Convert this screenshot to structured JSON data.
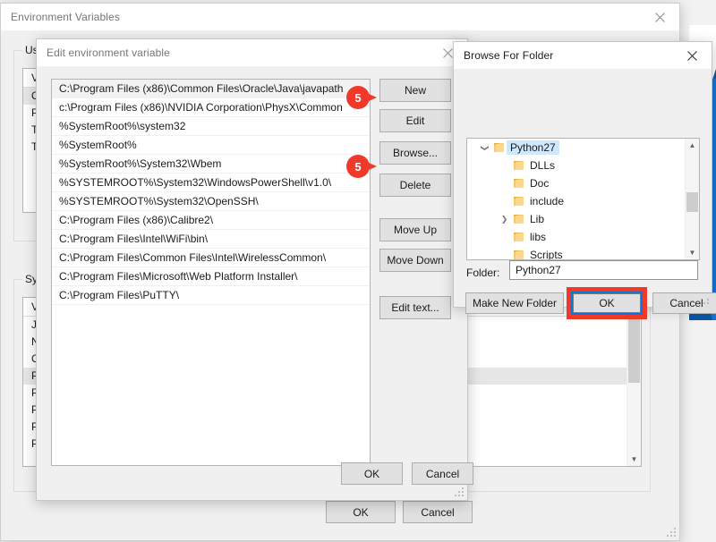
{
  "desktop": {
    "wallpaper_color": "#0b57a4"
  },
  "env_window": {
    "title": "Environment Variables",
    "close_icon": "close-icon",
    "user_group": "User variables for user",
    "system_group": "System variables",
    "user_header": "Variable",
    "user_rows": [
      "OneDrive",
      "Path",
      "TEMP",
      "TMP"
    ],
    "system_header": "Variable",
    "system_rows": [
      "JAVA_HOME",
      "NUMBER_OF_PROCESSORS",
      "OS",
      "Path",
      "PATHEXT",
      "PROCESSOR_ARCHITECTURE",
      "PROCESSOR_IDENTIFIER",
      "PR"
    ],
    "system_selected_index": 3,
    "user_selected_index": 0,
    "ok_label": "OK",
    "cancel_label": "Cancel"
  },
  "edit_window": {
    "title": "Edit environment variable",
    "close_icon": "close-icon",
    "paths": [
      "C:\\Program Files (x86)\\Common Files\\Oracle\\Java\\javapath",
      "c:\\Program Files (x86)\\NVIDIA Corporation\\PhysX\\Common",
      "%SystemRoot%\\system32",
      "%SystemRoot%",
      "%SystemRoot%\\System32\\Wbem",
      "%SYSTEMROOT%\\System32\\WindowsPowerShell\\v1.0\\",
      "%SYSTEMROOT%\\System32\\OpenSSH\\",
      "C:\\Program Files (x86)\\Calibre2\\",
      "C:\\Program Files\\Intel\\WiFi\\bin\\",
      "C:\\Program Files\\Common Files\\Intel\\WirelessCommon\\",
      "C:\\Program Files\\Microsoft\\Web Platform Installer\\",
      "C:\\Program Files\\PuTTY\\"
    ],
    "selected_index": 0,
    "buttons": {
      "new": "New",
      "edit": "Edit",
      "browse": "Browse...",
      "delete": "Delete",
      "move_up": "Move Up",
      "move_down": "Move Down",
      "edit_text": "Edit text...",
      "ok": "OK",
      "cancel": "Cancel"
    },
    "callouts": [
      {
        "number": "5",
        "target": "New"
      },
      {
        "number": "5",
        "target": "Browse..."
      }
    ]
  },
  "browse_window": {
    "title": "Browse For Folder",
    "close_icon": "close-icon",
    "tree": [
      {
        "label": "Python27",
        "depth": 0,
        "expander": "expanded",
        "selected": true
      },
      {
        "label": "DLLs",
        "depth": 1,
        "expander": "none",
        "selected": false
      },
      {
        "label": "Doc",
        "depth": 1,
        "expander": "none",
        "selected": false
      },
      {
        "label": "include",
        "depth": 1,
        "expander": "none",
        "selected": false
      },
      {
        "label": "Lib",
        "depth": 1,
        "expander": "collapsed",
        "selected": false
      },
      {
        "label": "libs",
        "depth": 1,
        "expander": "none",
        "selected": false
      },
      {
        "label": "Scripts",
        "depth": 1,
        "expander": "none",
        "selected": false
      }
    ],
    "folder_label": "Folder:",
    "folder_value": "Python27",
    "make_new_folder": "Make New Folder",
    "ok": "OK",
    "cancel": "Cancel",
    "highlight_color": "#f0392b",
    "focus_color": "#0a78d8"
  }
}
